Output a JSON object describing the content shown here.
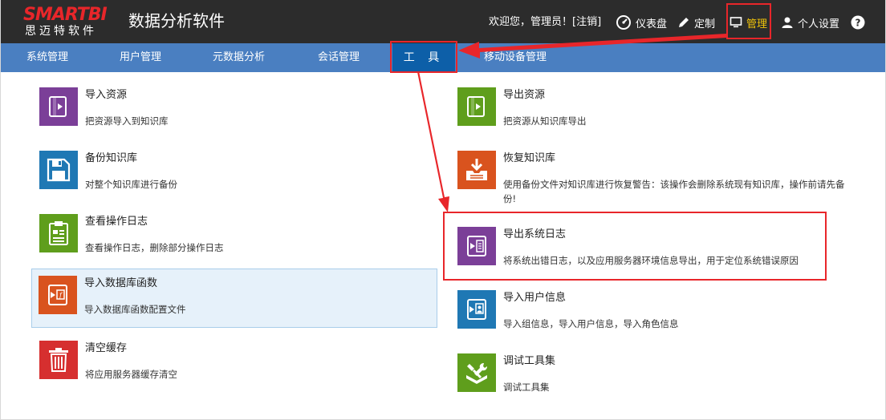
{
  "header": {
    "logo_main": "SMARTBI",
    "logo_sub": "思迈特软件",
    "app_title": "数据分析软件",
    "welcome_prefix": "欢迎您，管理员！[",
    "logout_label": "注销",
    "welcome_suffix": "]",
    "dashboard_label": "仪表盘",
    "customize_label": "定制",
    "admin_label": "管理",
    "settings_label": "个人设置",
    "help_label": "?",
    "active_color": "#f0c30a"
  },
  "nav": {
    "items": [
      {
        "label": "系统管理"
      },
      {
        "label": "用户管理"
      },
      {
        "label": "元数据分析"
      },
      {
        "label": "会话管理"
      },
      {
        "label": "工 具"
      },
      {
        "label": "移动设备管理"
      }
    ],
    "active_index": 4,
    "bar_color": "#4a7fc1",
    "active_color": "#0d5fa8"
  },
  "tools": {
    "left": [
      {
        "title": "导入资源",
        "desc": "把资源导入到知识库",
        "icon": "import-book-icon",
        "color": "#7b3f98"
      },
      {
        "title": "备份知识库",
        "desc": "对整个知识库进行备份",
        "icon": "floppy-disk-icon",
        "color": "#1f78b4"
      },
      {
        "title": "查看操作日志",
        "desc": "查看操作日志，删除部分操作日志",
        "icon": "clipboard-log-icon",
        "color": "#5f9e1c"
      },
      {
        "title": "导入数据库函数",
        "desc": "导入数据库函数配置文件",
        "icon": "import-function-icon",
        "color": "#d9531e"
      },
      {
        "title": "清空缓存",
        "desc": "将应用服务器缓存清空",
        "icon": "trash-icon",
        "color": "#d62f2f"
      }
    ],
    "right": [
      {
        "title": "导出资源",
        "desc": "把资源从知识库导出",
        "icon": "export-book-icon",
        "color": "#5f9e1c"
      },
      {
        "title": "恢复知识库",
        "desc": "使用备份文件对知识库进行恢复警告：该操作会删除系统现有知识库，操作前请先备份!",
        "icon": "restore-icon",
        "color": "#d9531e"
      },
      {
        "title": "导出系统日志",
        "desc": "将系统出错日志，以及应用服务器环境信息导出，用于定位系统错误原因",
        "icon": "export-log-icon",
        "color": "#7b3f98"
      },
      {
        "title": "导入用户信息",
        "desc": "导入组信息，导入用户信息，导入角色信息",
        "icon": "import-user-icon",
        "color": "#1f78b4"
      },
      {
        "title": "调试工具集",
        "desc": "调试工具集",
        "icon": "debug-tools-icon",
        "color": "#5f9e1c"
      }
    ]
  },
  "annotation_color": "#e8262a"
}
